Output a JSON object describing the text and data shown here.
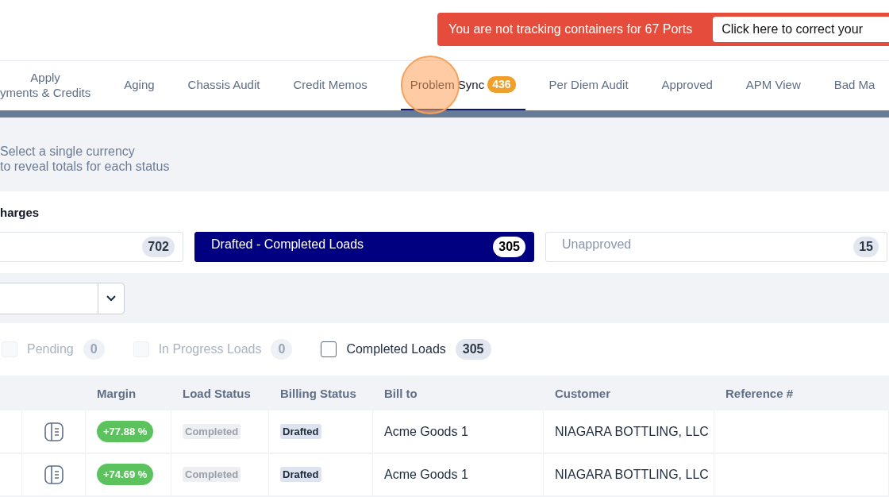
{
  "alert": {
    "message": "You are not tracking containers for 67 Ports",
    "action": "Click here to correct your"
  },
  "tabs": [
    {
      "lines": [
        "Apply",
        "yments & Credits"
      ],
      "selected": false,
      "highlighted": false
    },
    {
      "lines": [
        "Aging"
      ],
      "selected": false,
      "highlighted": false
    },
    {
      "lines": [
        "Chassis Audit"
      ],
      "selected": false,
      "highlighted": false
    },
    {
      "lines": [
        "Credit Memos"
      ],
      "selected": false,
      "highlighted": false
    },
    {
      "lines": [
        "Problem Sync"
      ],
      "badge": "436",
      "selected": true,
      "highlighted": true
    },
    {
      "lines": [
        "Per Diem Audit"
      ],
      "selected": false,
      "highlighted": false
    },
    {
      "lines": [
        "Approved"
      ],
      "selected": false,
      "highlighted": false
    },
    {
      "lines": [
        "APM View"
      ],
      "selected": false,
      "highlighted": false
    },
    {
      "lines": [
        "Bad Ma"
      ],
      "selected": false,
      "highlighted": false
    }
  ],
  "currency_hint": "Select a single currency\nto reveal totals for each status",
  "charges": {
    "title": "harges",
    "statuses": [
      {
        "count": "702",
        "selected": false
      },
      {
        "label": "Drafted - Completed Loads",
        "count": "305",
        "selected": true
      },
      {
        "label": "Unapproved",
        "count": "15",
        "selected": false
      }
    ]
  },
  "filters": [
    {
      "label": "Pending",
      "count": "0",
      "checked": false,
      "disabled": true
    },
    {
      "label": "In Progress Loads",
      "count": "0",
      "checked": false,
      "disabled": true
    },
    {
      "label": "Completed Loads",
      "count": "305",
      "checked": false,
      "disabled": false
    }
  ],
  "table": {
    "columns": [
      "Margin",
      "Load Status",
      "Billing Status",
      "Bill to",
      "Customer",
      "Reference #"
    ],
    "rows": [
      {
        "margin": "+77.88 %",
        "load_status": "Completed",
        "billing_status": "Drafted",
        "bill_to": "Acme Goods 1",
        "customer": "NIAGARA BOTTLING, LLC"
      },
      {
        "margin": "+74.69 %",
        "load_status": "Completed",
        "billing_status": "Drafted",
        "bill_to": "Acme Goods 1",
        "customer": "NIAGARA BOTTLING, LLC"
      }
    ]
  }
}
